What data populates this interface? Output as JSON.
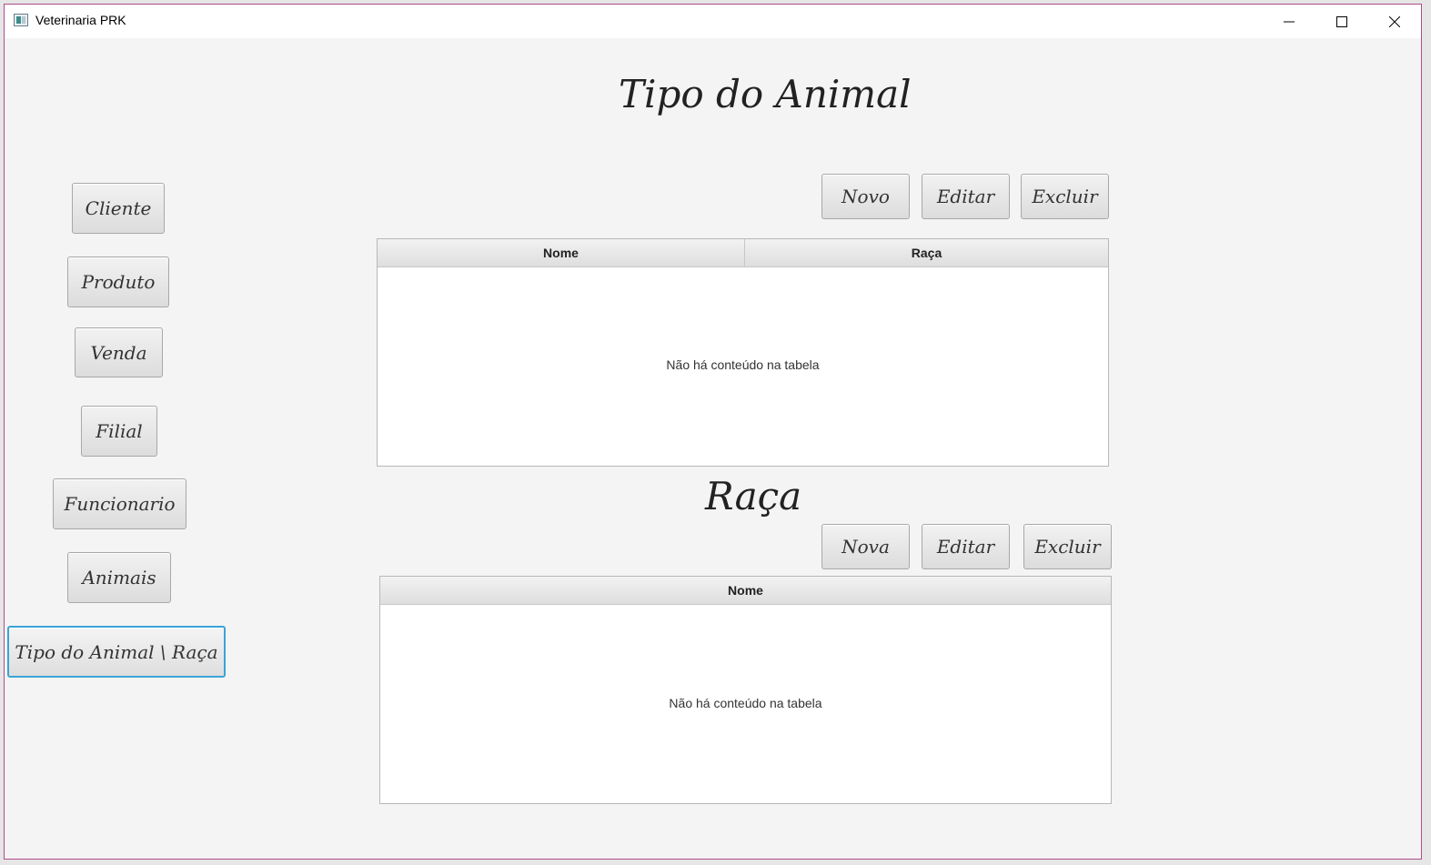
{
  "window": {
    "title": "Veterinaria PRK",
    "controls": [
      "minimize-icon",
      "maximize-icon",
      "close-icon"
    ]
  },
  "sidebar": {
    "items": [
      {
        "label": "Cliente"
      },
      {
        "label": "Produto"
      },
      {
        "label": "Venda"
      },
      {
        "label": "Filial"
      },
      {
        "label": "Funcionario"
      },
      {
        "label": "Animais"
      },
      {
        "label": "Tipo do Animal \\ Raça",
        "active": true
      }
    ]
  },
  "tipo_animal": {
    "title": "Tipo do Animal",
    "buttons": {
      "new": "Novo",
      "edit": "Editar",
      "delete": "Excluir"
    },
    "table": {
      "columns": [
        "Nome",
        "Raça"
      ],
      "rows": [],
      "empty_text": "Não há conteúdo na tabela"
    }
  },
  "raca": {
    "title": "Raça",
    "buttons": {
      "new": "Nova",
      "edit": "Editar",
      "delete": "Excluir"
    },
    "table": {
      "columns": [
        "Nome"
      ],
      "rows": [],
      "empty_text": "Não há conteúdo na tabela"
    }
  },
  "colors": {
    "focus_ring": "#3aa3d8",
    "window_border": "#b04c8c",
    "background": "#f4f4f4"
  }
}
